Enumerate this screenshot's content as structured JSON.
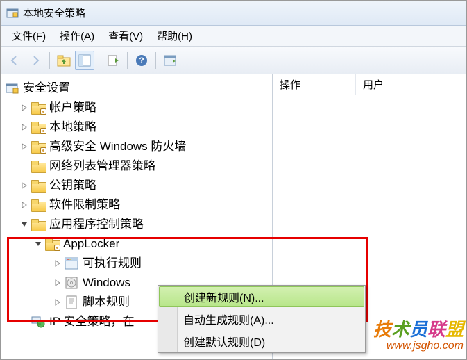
{
  "title": "本地安全策略",
  "menubar": {
    "file": "文件(F)",
    "action": "操作(A)",
    "view": "查看(V)",
    "help": "帮助(H)"
  },
  "right_panel": {
    "col0": "操作",
    "col1": "用户"
  },
  "tree": {
    "root": "安全设置",
    "account_policy": "帐户策略",
    "local_policy": "本地策略",
    "firewall": "高级安全 Windows 防火墙",
    "network_list": "网络列表管理器策略",
    "public_key": "公钥策略",
    "software_restriction": "软件限制策略",
    "app_control": "应用程序控制策略",
    "applocker": "AppLocker",
    "exe_rules": "可执行规则",
    "installer_rules": "Windows",
    "script_rules": "脚本规则",
    "ip_security": "IP 安全策略，在"
  },
  "context_menu": {
    "create_new": "创建新规则(N)...",
    "auto_gen": "自动生成规则(A)...",
    "create_default": "创建默认规则(D)"
  },
  "watermark": {
    "brand": "技术员联盟",
    "url": "www.jsgho.com"
  }
}
